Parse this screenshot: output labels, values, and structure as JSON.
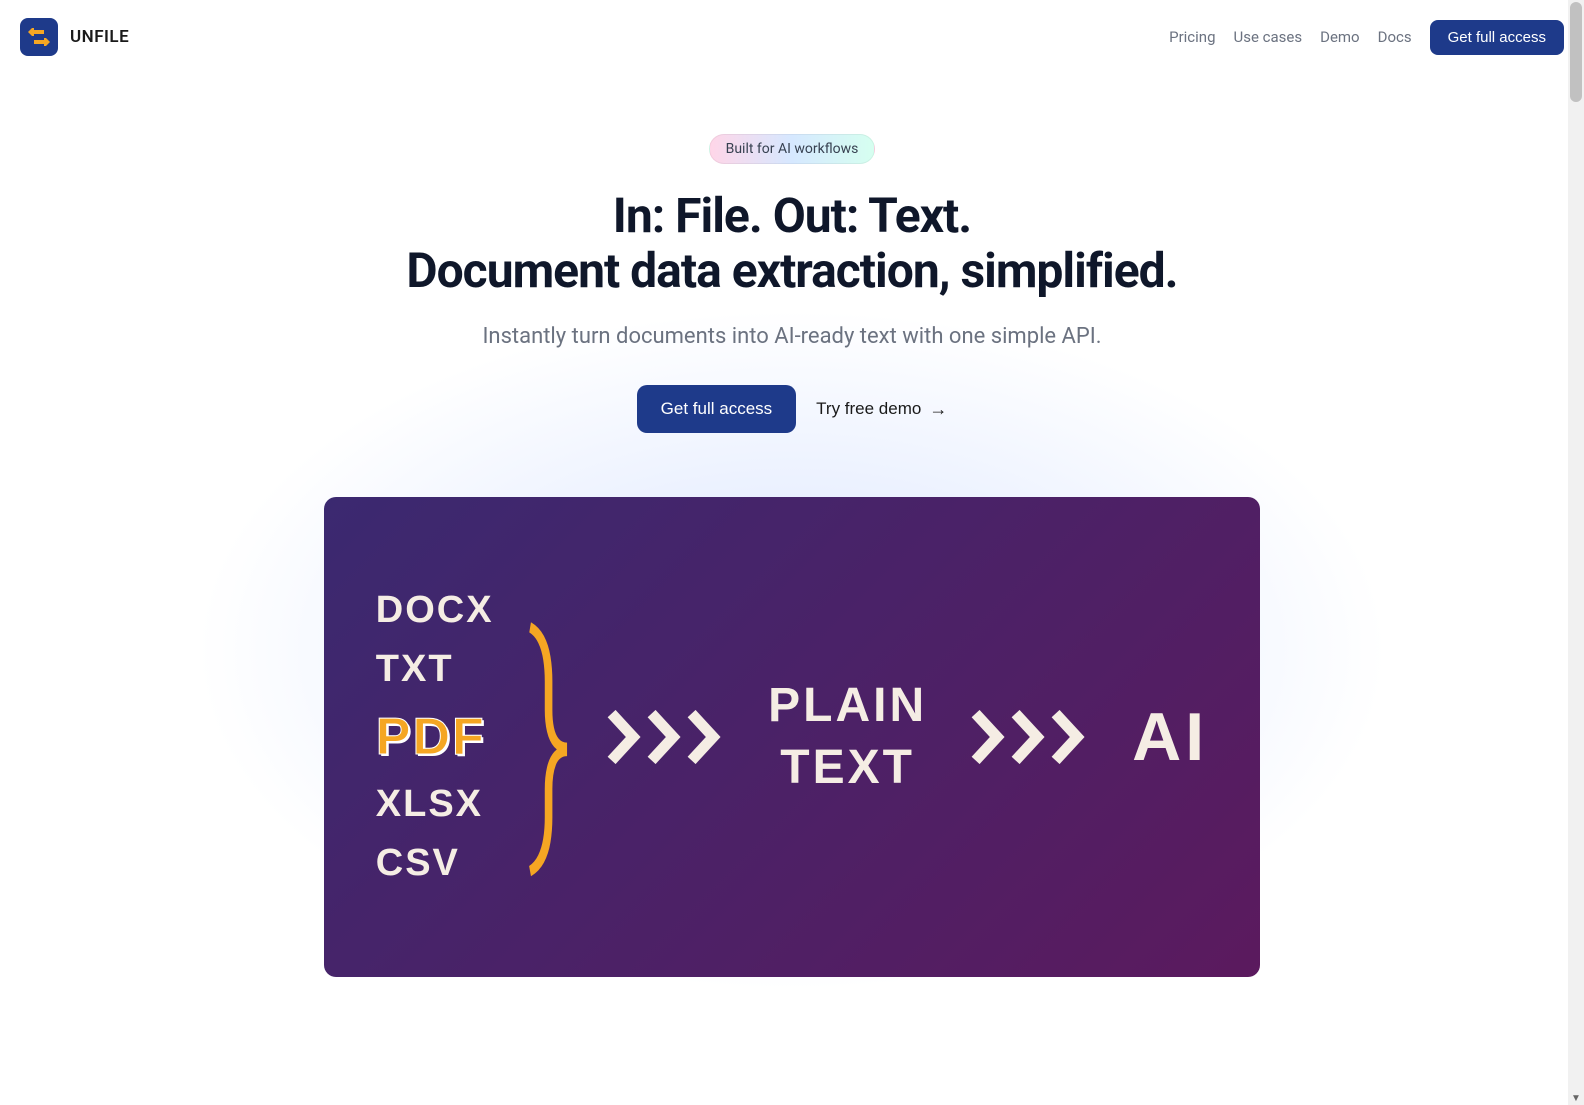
{
  "brand": {
    "name": "UNFILE"
  },
  "nav": {
    "links": [
      "Pricing",
      "Use cases",
      "Demo",
      "Docs"
    ],
    "cta": "Get full access"
  },
  "hero": {
    "badge": "Built for AI workflows",
    "title_line1": "In: File. Out: Text.",
    "title_line2": "Document data extraction, simplified.",
    "subtitle": "Instantly turn documents into AI-ready text with one simple API.",
    "primary_button": "Get full access",
    "secondary_button": "Try free demo"
  },
  "illustration": {
    "file_types": [
      "DOCX",
      "TXT",
      "PDF",
      "XLSX",
      "CSV"
    ],
    "highlighted_index": 2,
    "output_line1": "PLAIN",
    "output_line2": "TEXT",
    "ai_label": "AI"
  }
}
